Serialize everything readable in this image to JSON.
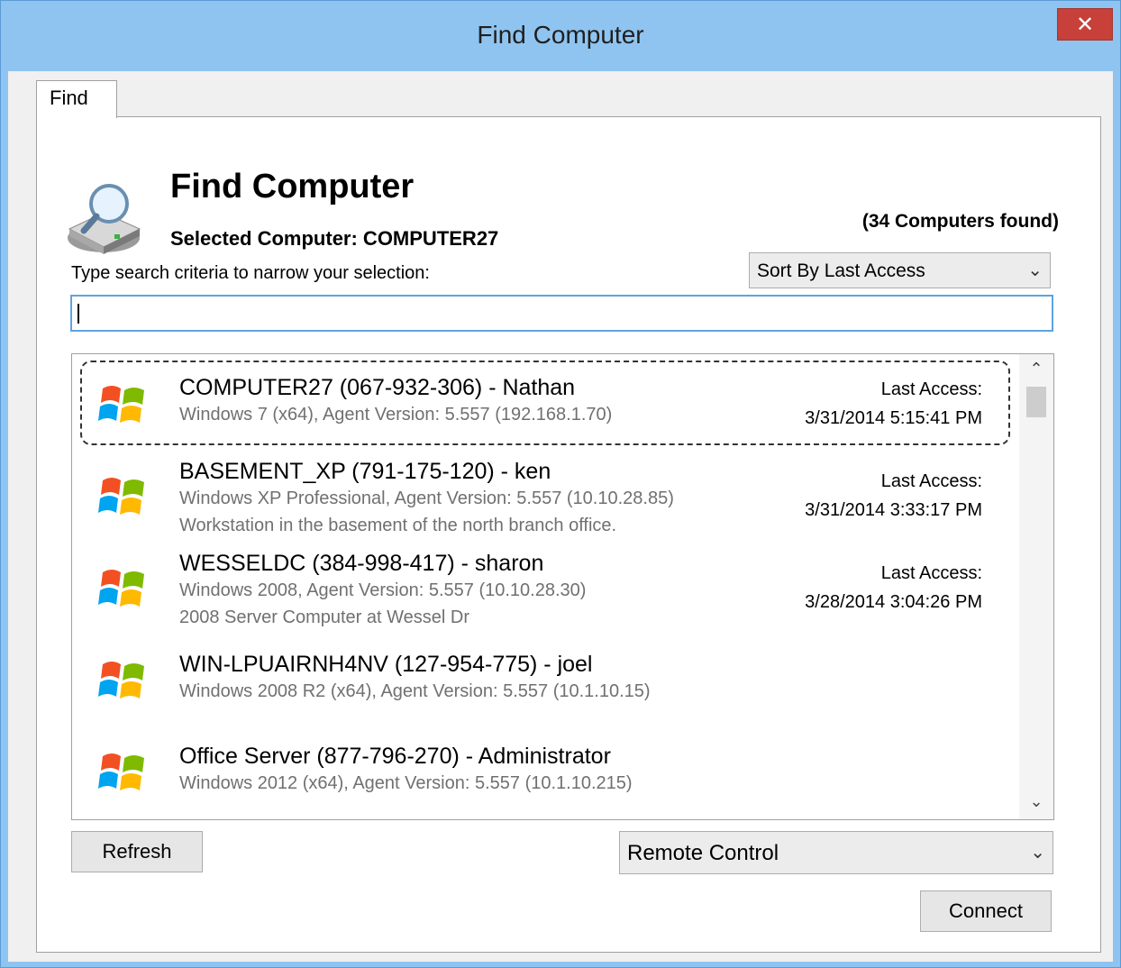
{
  "window": {
    "title": "Find Computer",
    "close_label": "✕"
  },
  "tabs": [
    {
      "label": "Find"
    }
  ],
  "header": {
    "heading": "Find Computer",
    "selected_computer": "Selected Computer: COMPUTER27",
    "count": "(34 Computers found)",
    "criteria_label": "Type search criteria to narrow your selection:"
  },
  "sort": {
    "selected": "Sort By Last Access"
  },
  "search": {
    "value": ""
  },
  "computers": [
    {
      "name": "COMPUTER27 (067-932-306) - Nathan",
      "os": "Windows 7 (x64), Agent Version: 5.557 (192.168.1.70)",
      "description": "",
      "last_access_label": "Last Access:",
      "last_access": "3/31/2014 5:15:41 PM"
    },
    {
      "name": "BASEMENT_XP (791-175-120) - ken",
      "os": "Windows XP Professional, Agent Version: 5.557 (10.10.28.85)",
      "description": "Workstation in the basement of the north branch office.",
      "last_access_label": "Last Access:",
      "last_access": "3/31/2014 3:33:17 PM"
    },
    {
      "name": "WESSELDC (384-998-417) - sharon",
      "os": "Windows 2008, Agent Version: 5.557 (10.10.28.30)",
      "description": "2008 Server Computer at Wessel Dr",
      "last_access_label": "Last Access:",
      "last_access": "3/28/2014 3:04:26 PM"
    },
    {
      "name": "WIN-LPUAIRNH4NV (127-954-775) - joel",
      "os": "Windows 2008 R2 (x64), Agent Version: 5.557 (10.1.10.15)",
      "description": "",
      "last_access_label": "",
      "last_access": ""
    },
    {
      "name": "Office Server (877-796-270) - Administrator",
      "os": "Windows 2012 (x64), Agent Version: 5.557 (10.1.10.215)",
      "description": "",
      "last_access_label": "",
      "last_access": ""
    }
  ],
  "buttons": {
    "refresh": "Refresh",
    "connect": "Connect"
  },
  "action": {
    "selected": "Remote Control"
  },
  "icons": {
    "dropdown": "chevron-down-icon",
    "logo": "computer-search-icon",
    "os": "windows-logo-icon"
  }
}
